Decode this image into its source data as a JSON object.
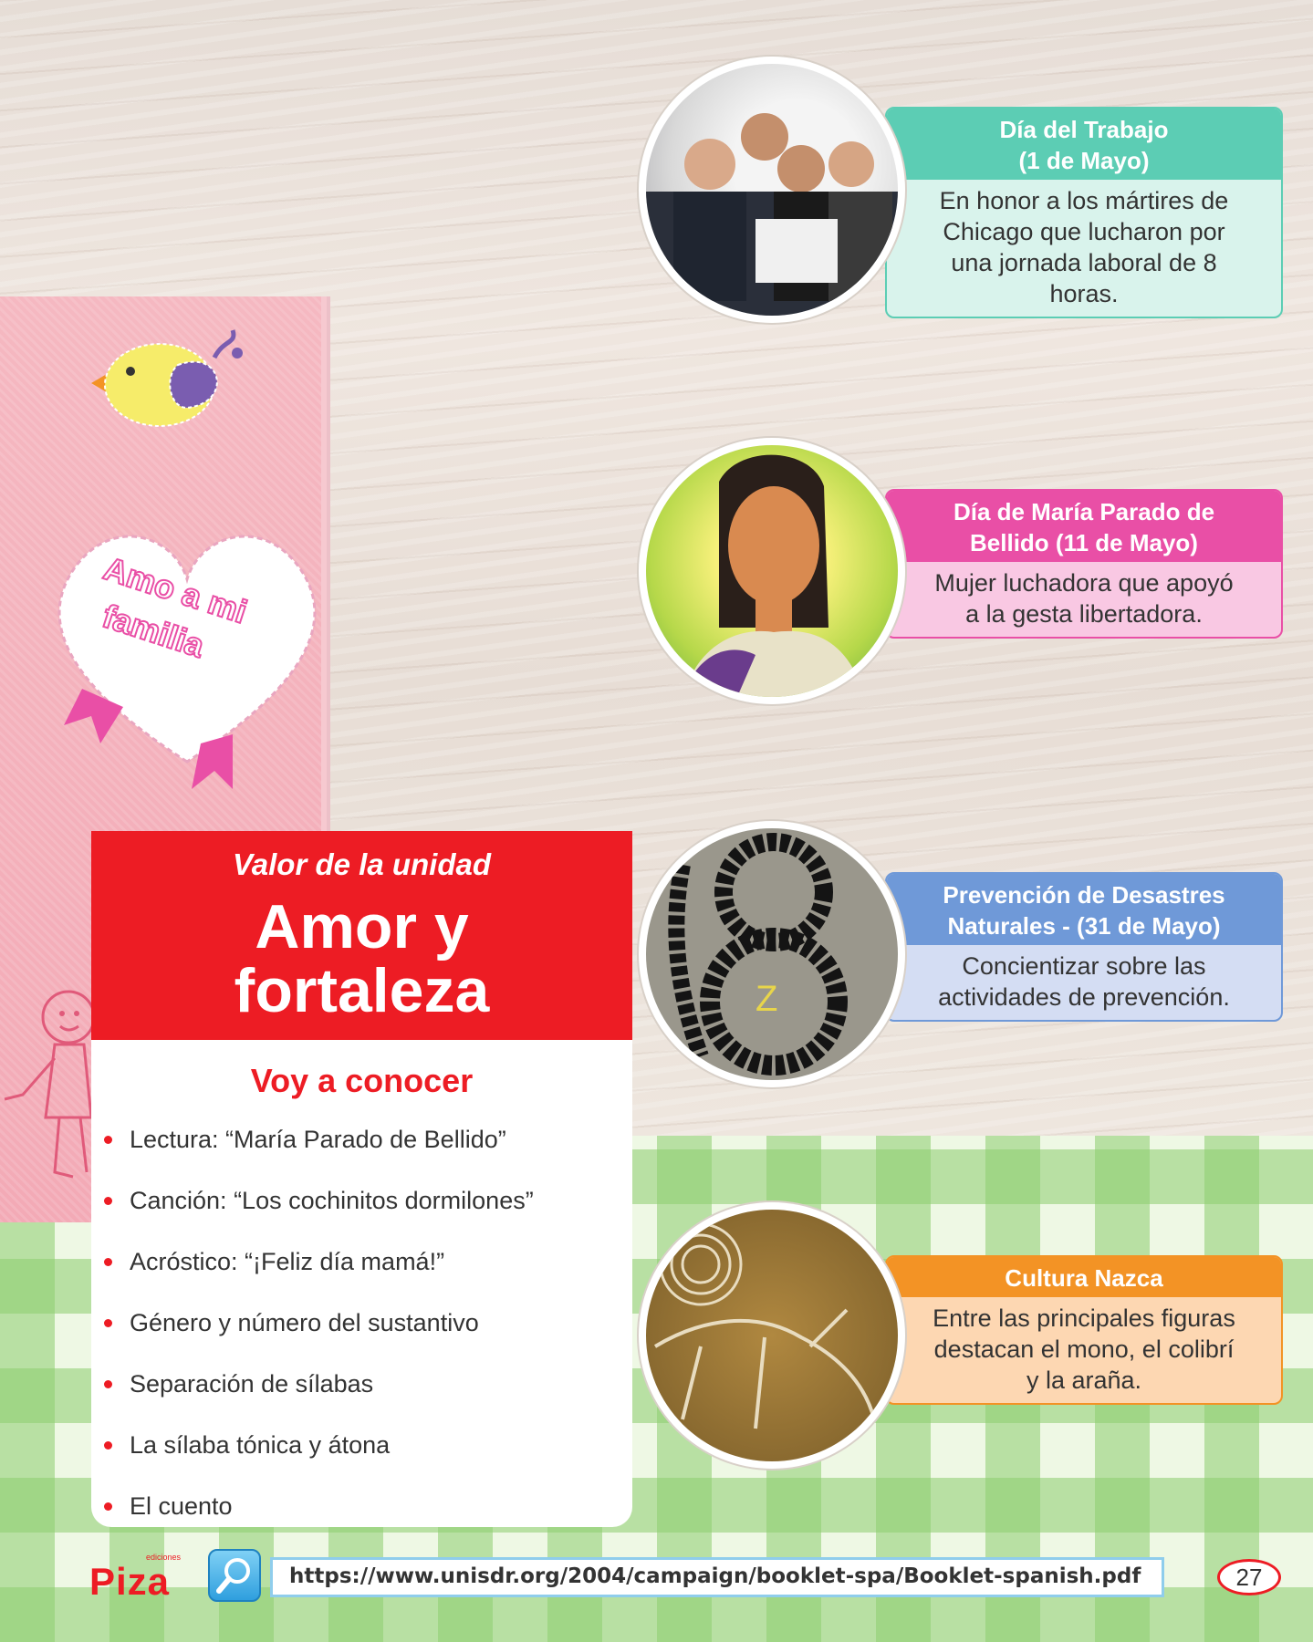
{
  "colors": {
    "red": "#ed1c24",
    "teal": "#5ccdb4",
    "magenta": "#e94fa6",
    "blue": "#6f99d8",
    "orange": "#f39325"
  },
  "sticker": {
    "text_line1": "Amo a mi",
    "text_line2": "familia"
  },
  "unit": {
    "subtitle": "Valor de la unidad",
    "title_line1": "Amor y",
    "title_line2": "fortaleza",
    "list_header": "Voy a conocer",
    "topics": [
      "Lectura: “María Parado de Bellido”",
      "Canción: “Los cochinitos dormilones”",
      "Acróstico: “¡Feliz día mamá!”",
      "Género y número del sustantivo",
      "Separación de sílabas",
      "La sílaba tónica y átona",
      "El cuento"
    ]
  },
  "events": [
    {
      "title_line1": "Día del Trabajo",
      "title_line2": "(1 de Mayo)",
      "body": [
        "En honor a los mártires de",
        "Chicago que lucharon por",
        "una jornada laboral de 8",
        "horas."
      ],
      "icon": "office-workers-photo"
    },
    {
      "title_line1": "Día de María Parado de",
      "title_line2": "Bellido (11 de Mayo)",
      "body": [
        "Mujer luchadora que apoyó",
        "a la gesta libertadora."
      ],
      "icon": "portrait-photo"
    },
    {
      "title_line1": "Prevención de Desastres",
      "title_line2": "Naturales - (31 de Mayo)",
      "body": [
        "Concientizar sobre las",
        "actividades de prevención."
      ],
      "icon": "students-drill-photo"
    },
    {
      "title_line1": "Cultura Nazca",
      "title_line2": "",
      "body": [
        "Entre las principales figuras",
        "destacan el mono, el colibrí",
        "y la araña."
      ],
      "icon": "nazca-lines-photo"
    }
  ],
  "footer": {
    "brand": "Piza",
    "brand_small": "ediciones",
    "url": "https://www.unisdr.org/2004/campaign/booklet-spa/Booklet-spanish.pdf",
    "page_number": "27"
  }
}
